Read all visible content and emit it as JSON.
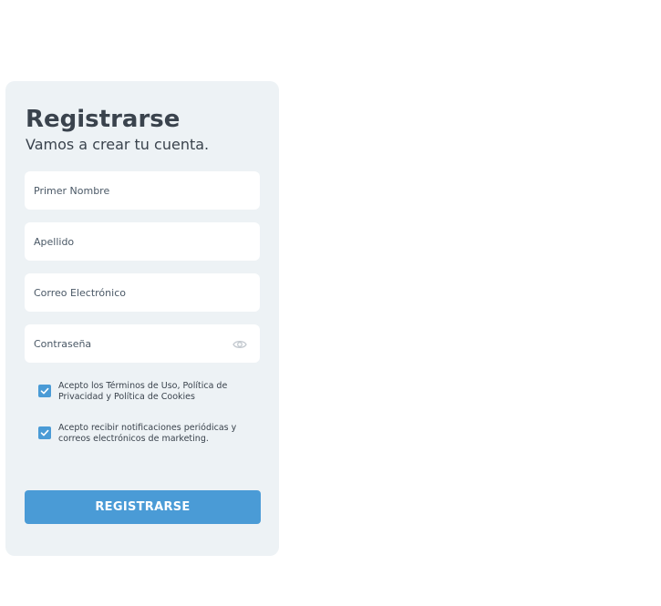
{
  "form": {
    "title": "Registrarse",
    "subtitle": "Vamos a crear tu cuenta.",
    "fields": {
      "first_name": {
        "placeholder": "Primer Nombre",
        "value": ""
      },
      "last_name": {
        "placeholder": "Apellido",
        "value": ""
      },
      "email": {
        "placeholder": "Correo Electrónico",
        "value": ""
      },
      "password": {
        "placeholder": "Contraseña",
        "value": "",
        "toggle_icon": "eye-icon"
      }
    },
    "checkboxes": [
      {
        "label": "Acepto los Términos de Uso, Política de Privacidad y Política de Cookies",
        "checked": true
      },
      {
        "label": "Acepto recibir notificaciones periódicas y correos electrónicos de marketing.",
        "checked": true
      }
    ],
    "submit_label": "REGISTRARSE"
  },
  "colors": {
    "card_background": "#edf2f5",
    "accent": "#4a9bd6",
    "text": "#3a434d",
    "input_background": "#ffffff"
  }
}
